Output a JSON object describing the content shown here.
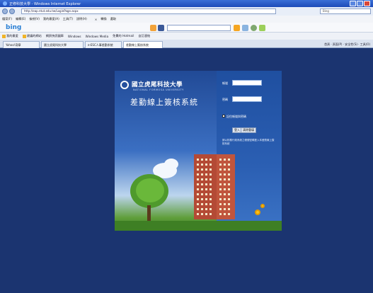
{
  "browser": {
    "title": "正修科技大學 - Windows Internet Explorer",
    "url": "http://eap.ntut.edu.tw/LoginPage.aspx",
    "addr_search": "Bing",
    "menu": [
      "檔案(F)",
      "編輯(E)",
      "檢視(V)",
      "我的最愛(A)",
      "工具(T)",
      "說明(H)",
      "×",
      "轉換",
      "選取"
    ],
    "bing_logo": "bing",
    "favorites": [
      "我的最愛",
      "建議的網站",
      "網頁快訊圖庫",
      "Windows",
      "Windows Media",
      "免費的 Hotmail",
      "自訂連結"
    ],
    "tabs": [
      "Yahoo!奇摩",
      "國立虎尾科技大學",
      "e-ESC人事差勤系統",
      "差勤線上簽核系統"
    ],
    "command_bar": "首頁  ·  頁面(P)  ·  安全性(S)  ·  工具(O)"
  },
  "portal": {
    "school_name": "國立虎尾科技大學",
    "school_english": "NATIONAL FORMOSA UNIVERSITY",
    "system_title": "差勤線上簽核系統",
    "account_label": "帳號",
    "password_label": "密碼",
    "remember_label": "記住帳號與密碼",
    "login_button": "登入",
    "cancel_button": "清除重填",
    "note": "請以校務行政系統之帳號密碼登入本差勤線上簽核系統"
  }
}
